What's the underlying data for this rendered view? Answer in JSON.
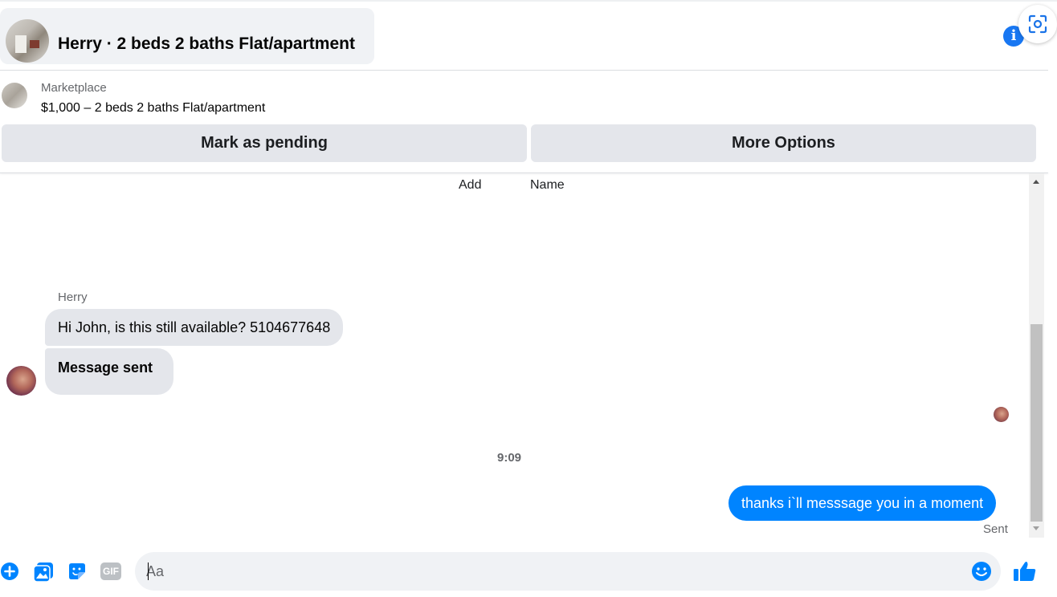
{
  "header": {
    "title": "Herry · 2 beds 2 baths Flat/apartment",
    "avatar_icon": "listing-photo-avatar",
    "info_icon": "info-icon",
    "lens_icon": "visual-search-icon",
    "accent_color": "#1877f2"
  },
  "listing": {
    "source": "Marketplace",
    "summary": "$1,000 – 2 beds 2 baths Flat/apartment",
    "mark_pending_label": "Mark as pending",
    "more_options_label": "More Options"
  },
  "conversation": {
    "add_label": "Add",
    "name_label": "Name",
    "sender": "Herry",
    "incoming": [
      "Hi John, is this still available? 5104677648",
      "Message sent"
    ],
    "timestamp": "9:09",
    "outgoing": "thanks i`ll messsage you in a moment",
    "outgoing_color": "#0084ff",
    "status": "Sent"
  },
  "composer": {
    "placeholder": "Aa",
    "icons": [
      "plus-circle-icon",
      "photo-icon",
      "sticker-icon",
      "gif-icon",
      "emoji-icon",
      "thumbs-up-icon"
    ],
    "gif_text": "GIF"
  }
}
